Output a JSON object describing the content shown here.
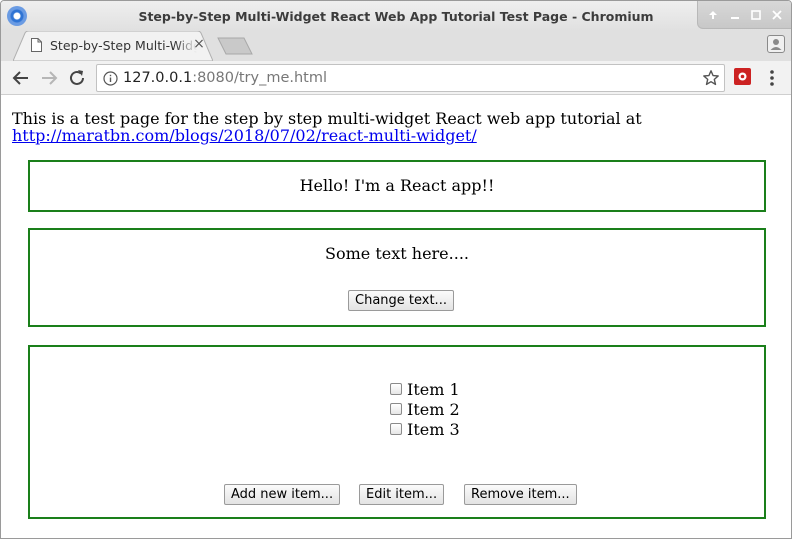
{
  "window": {
    "title": "Step-by-Step Multi-Widget React Web App Tutorial Test Page - Chromium"
  },
  "tabs": [
    {
      "title": "Step-by-Step Multi-Widget React Web App Tutorial Test Page",
      "close_glyph": "×"
    }
  ],
  "address_bar": {
    "url_host": "127.0.0.1",
    "url_rest": ":8080/try_me.html"
  },
  "page": {
    "intro_text": "This is a test page for the step by step multi-widget React web app tutorial at",
    "link_text": "http://maratbn.com/blogs/2018/07/02/react-multi-widget/",
    "widget1": {
      "text": "Hello! I'm a React app!!"
    },
    "widget2": {
      "text": "Some text here....",
      "button_label": "Change text..."
    },
    "widget3": {
      "items": [
        {
          "label": "Item 1",
          "checked": false
        },
        {
          "label": "Item 2",
          "checked": false
        },
        {
          "label": "Item 3",
          "checked": false
        }
      ],
      "add_label": "Add new item...",
      "edit_label": "Edit item...",
      "remove_label": "Remove item..."
    }
  },
  "colors": {
    "widget_border": "#1a7f1a",
    "link": "#0000ee"
  }
}
